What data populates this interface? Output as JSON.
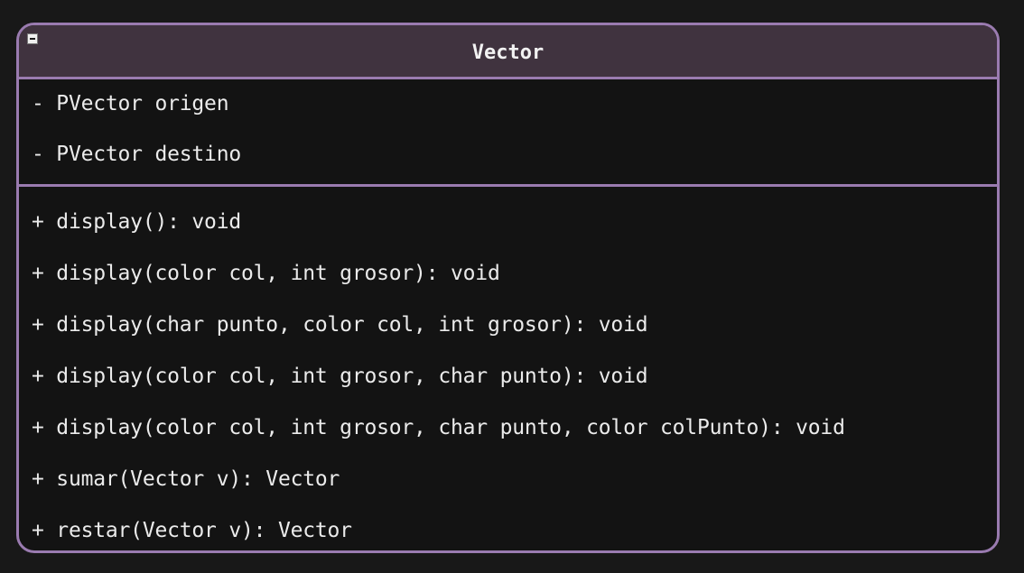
{
  "class": {
    "name": "Vector",
    "attributes": [
      "- PVector origen",
      "- PVector destino"
    ],
    "methods": [
      "+ display(): void",
      "+ display(color col, int grosor): void",
      "+ display(char punto, color col, int grosor): void",
      "+ display(color col, int grosor, char punto): void",
      "+ display(color col, int grosor, char punto, color colPunto): void",
      "+ sumar(Vector v): Vector",
      "+ restar(Vector v): Vector"
    ]
  },
  "colors": {
    "background": "#181818",
    "box_fill": "#131313",
    "header_fill": "#40333f",
    "border": "#9a7bb0",
    "text": "#ebebeb"
  },
  "icons": {
    "collapse": "minus-square-icon"
  }
}
